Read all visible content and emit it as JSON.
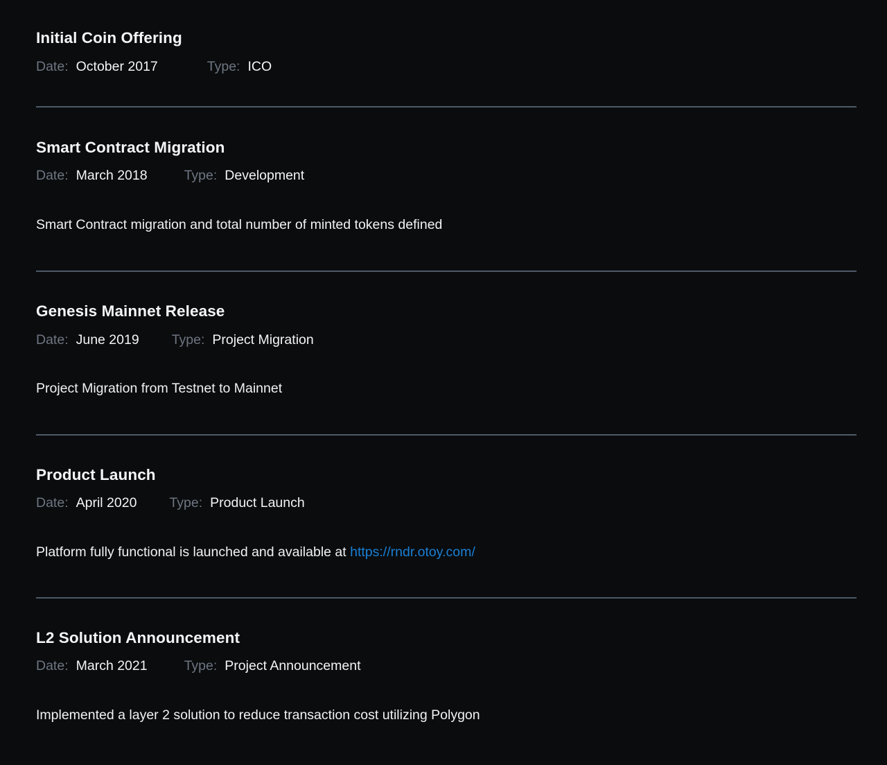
{
  "theme": {
    "background": "#0a0c0e",
    "text": "#f2f4f6",
    "muted_label": "#6e7681",
    "divider": "#4e5a68",
    "link": "#1a7fd4"
  },
  "labels": {
    "date": "Date:",
    "type": "Type:"
  },
  "entries": [
    {
      "title": "Initial Coin Offering",
      "date": "October 2017",
      "type": "ICO",
      "description": ""
    },
    {
      "title": "Smart Contract Migration",
      "date": "March 2018",
      "type": "Development",
      "description": "Smart Contract migration and total number of minted tokens defined"
    },
    {
      "title": "Genesis Mainnet Release",
      "date": "June 2019",
      "type": "Project Migration",
      "description": "Project Migration from Testnet to Mainnet"
    },
    {
      "title": "Product Launch",
      "date": "April 2020",
      "type": "Product Launch",
      "description_prefix": "Platform fully functional is launched and available at ",
      "link_text": "https://rndr.otoy.com/"
    },
    {
      "title": "L2 Solution Announcement",
      "date": "March 2021",
      "type": "Project Announcement",
      "description": "Implemented a layer 2 solution to reduce transaction cost utilizing Polygon"
    }
  ]
}
